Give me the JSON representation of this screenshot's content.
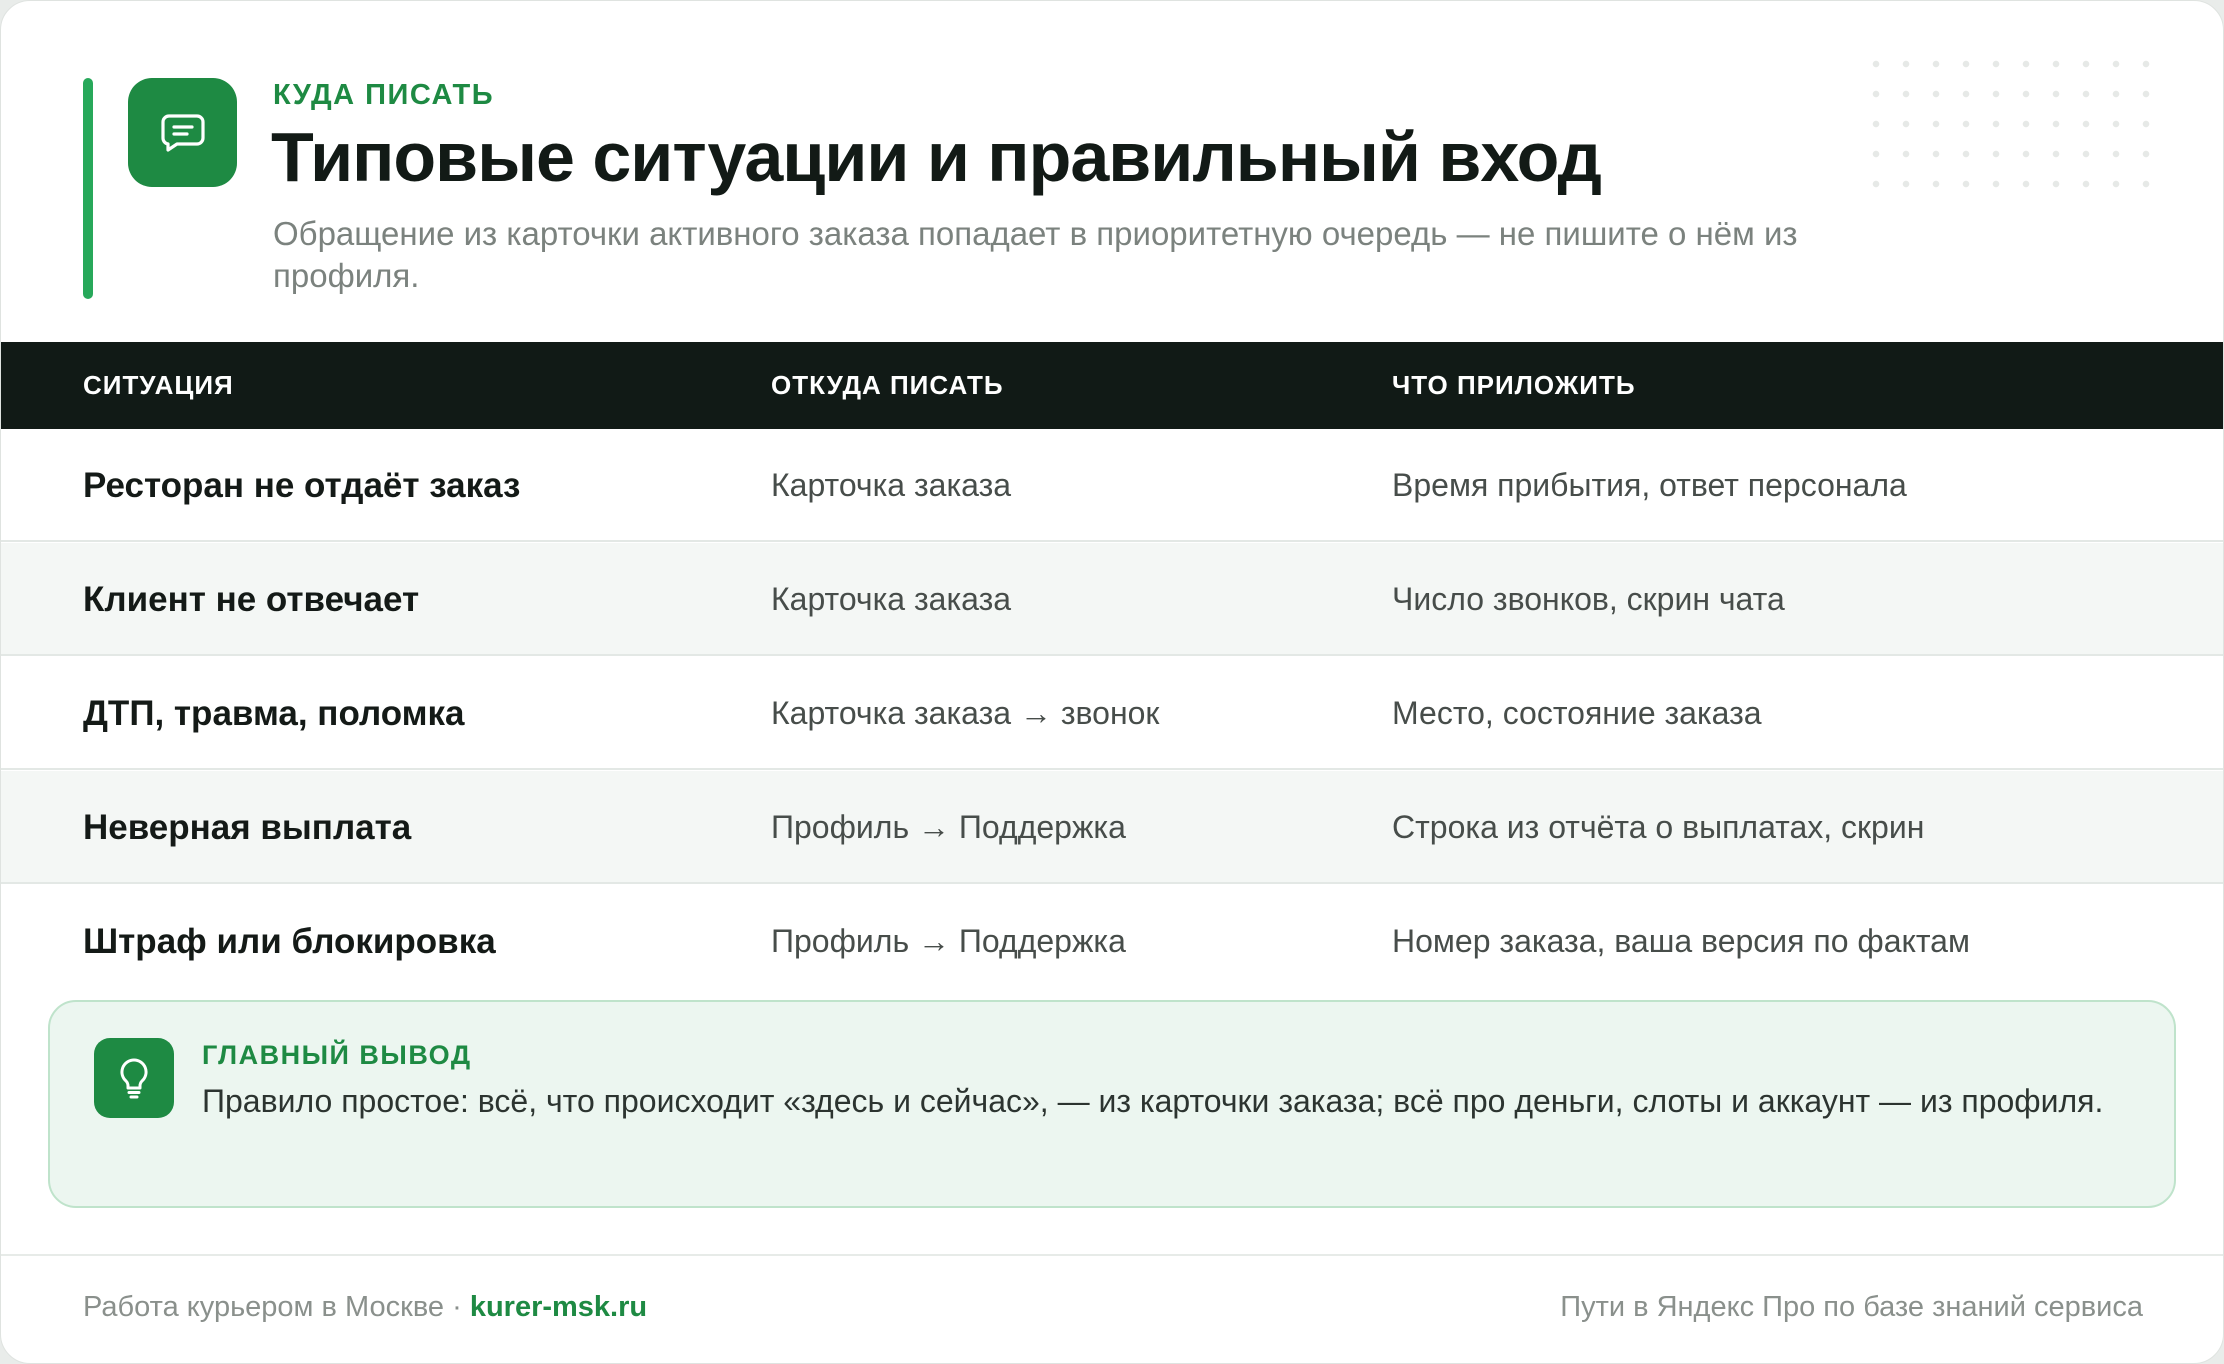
{
  "header": {
    "eyebrow": "КУДА ПИСАТЬ",
    "title": "Типовые ситуации и правильный вход",
    "subtitle": "Обращение из карточки активного заказа попадает в приоритетную очередь — не пишите о нём из профиля.",
    "icon": "chat-message-icon"
  },
  "table": {
    "columns": [
      "СИТУАЦИЯ",
      "ОТКУДА ПИСАТЬ",
      "ЧТО ПРИЛОЖИТЬ"
    ],
    "rows": [
      {
        "situation": "Ресторан не отдаёт заказ",
        "from": "Карточка заказа",
        "attach": "Время прибытия, ответ персонала"
      },
      {
        "situation": "Клиент не отвечает",
        "from": "Карточка заказа",
        "attach": "Число звонков, скрин чата"
      },
      {
        "situation": "ДТП, травма, поломка",
        "from": "Карточка заказа → звонок",
        "attach": "Место, состояние заказа"
      },
      {
        "situation": "Неверная выплата",
        "from": "Профиль → Поддержка",
        "attach": "Строка из отчёта о выплатах, скрин"
      },
      {
        "situation": "Штраф или блокировка",
        "from": "Профиль → Поддержка",
        "attach": "Номер заказа, ваша версия по фактам"
      }
    ]
  },
  "conclusion": {
    "label": "ГЛАВНЫЙ ВЫВОД",
    "text": "Правило простое: всё, что происходит «здесь и сейчас», — из карточки заказа; всё про деньги, слоты и аккаунт — из профиля.",
    "icon": "lightbulb-icon"
  },
  "footer": {
    "left_text": "Работа курьером в Москве ·",
    "link": "kurer-msk.ru",
    "right_text": "Пути в Яндекс Про по базе знаний сервиса"
  },
  "colors": {
    "accent": "#1e8a43",
    "accent_bar": "#27a85a",
    "table_header": "#111a16",
    "conclusion_bg": "#ecf6f0"
  }
}
